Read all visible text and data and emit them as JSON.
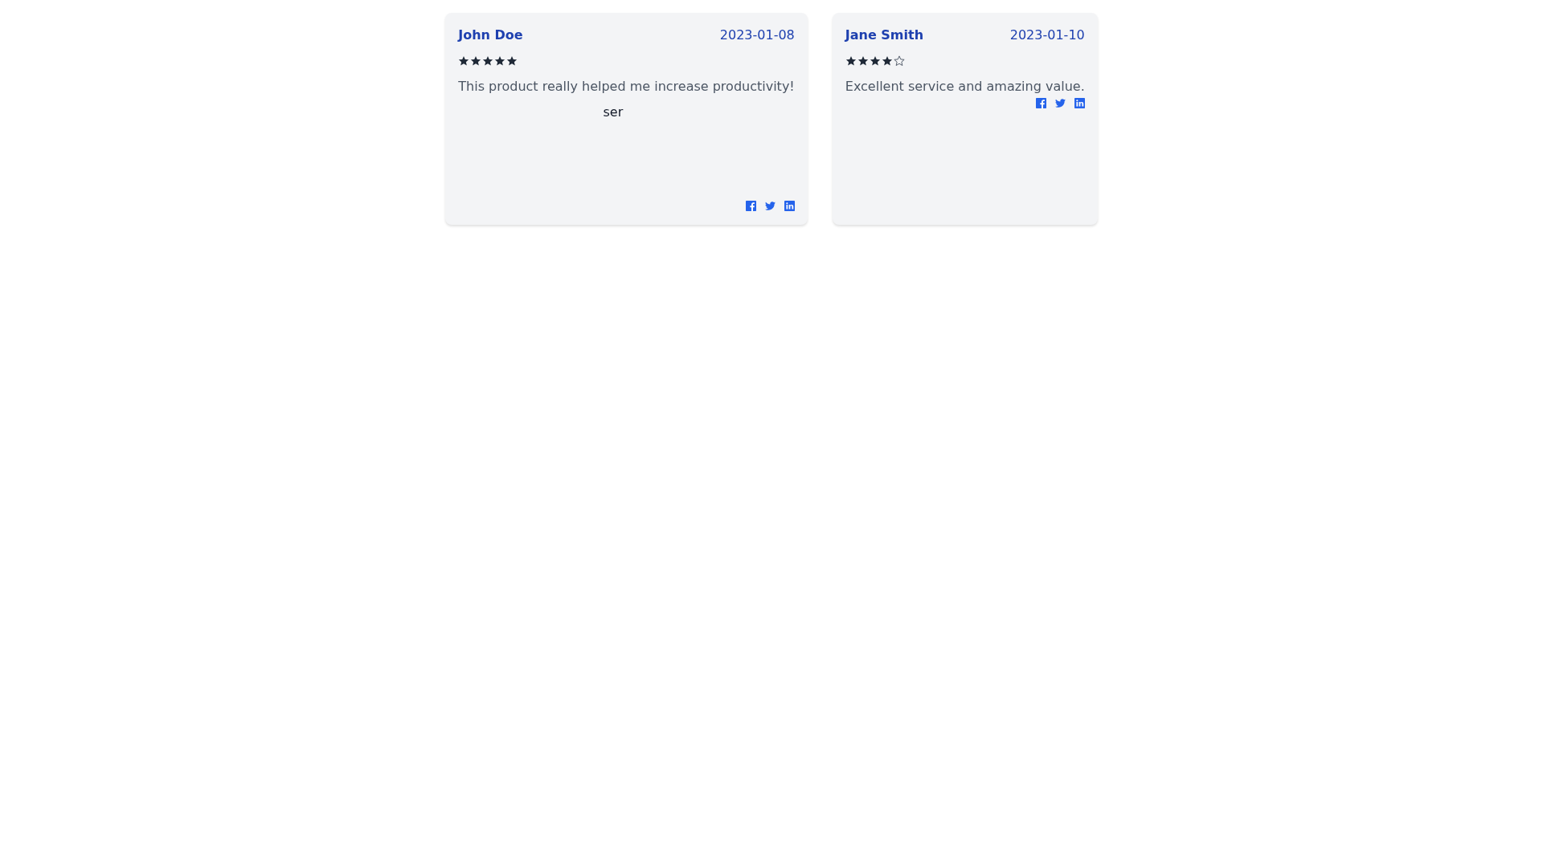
{
  "reviews": [
    {
      "name": "John Doe",
      "date": "2023-01-08",
      "stars": 5,
      "text": "This product really helped me increase productivity!",
      "image_alt_text": "ser"
    },
    {
      "name": "Jane Smith",
      "date": "2023-01-10",
      "stars": 4,
      "text": "Excellent service and amazing value."
    }
  ]
}
